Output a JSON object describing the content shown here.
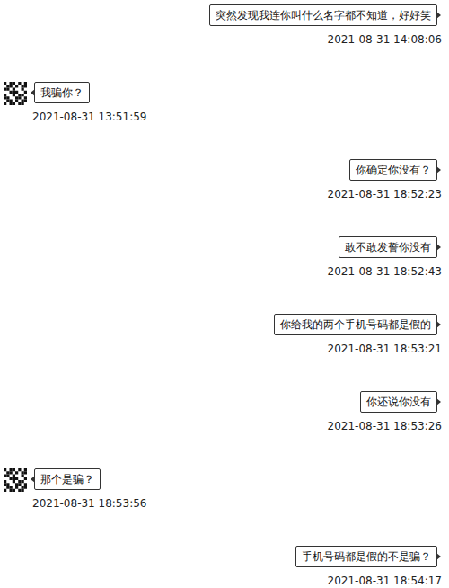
{
  "messages": [
    {
      "kind": "sent",
      "text": "突然发现我连你叫什么名字都不知道，好好笑",
      "time": "2021-08-31 14:08:06"
    },
    {
      "kind": "received",
      "text": "我骗你？",
      "time": "2021-08-31 13:51:59"
    },
    {
      "kind": "sent",
      "text": "你确定你没有？",
      "time": "2021-08-31 18:52:23"
    },
    {
      "kind": "sent",
      "text": "敢不敢发誓你没有",
      "time": "2021-08-31 18:52:43"
    },
    {
      "kind": "sent",
      "text": "你给我的两个手机号码都是假的",
      "time": "2021-08-31 18:53:21"
    },
    {
      "kind": "sent",
      "text": "你还说你没有",
      "time": "2021-08-31 18:53:26"
    },
    {
      "kind": "received",
      "text": "那个是骗？",
      "time": "2021-08-31 18:53:56"
    },
    {
      "kind": "sent",
      "text": "手机号码都是假的不是骗？",
      "time": "2021-08-31 18:54:17"
    }
  ]
}
